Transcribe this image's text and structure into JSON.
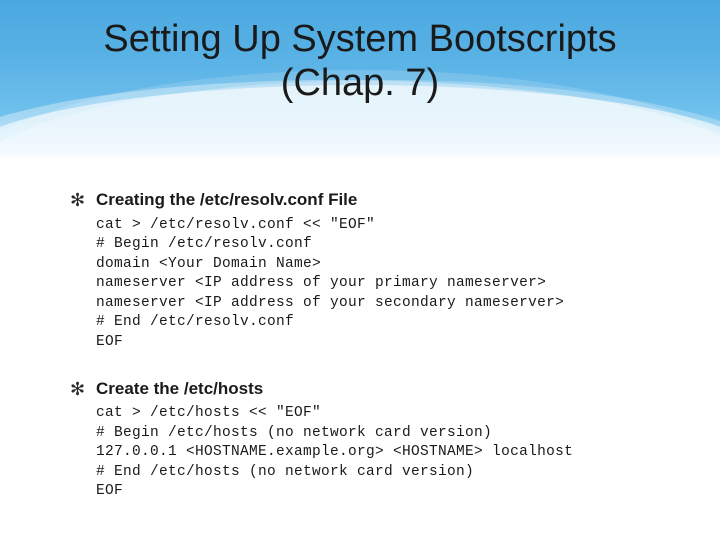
{
  "title_line1": "Setting Up System Bootscripts",
  "title_line2": "(Chap. 7)",
  "sections": [
    {
      "heading": "Creating the /etc/resolv.conf File",
      "code": "cat > /etc/resolv.conf << \"EOF\"\n# Begin /etc/resolv.conf\ndomain <Your Domain Name>\nnameserver <IP address of your primary nameserver>\nnameserver <IP address of your secondary nameserver>\n# End /etc/resolv.conf\nEOF"
    },
    {
      "heading": "Create the /etc/hosts",
      "code": "cat > /etc/hosts << \"EOF\"\n# Begin /etc/hosts (no network card version)\n127.0.0.1 <HOSTNAME.example.org> <HOSTNAME> localhost\n# End /etc/hosts (no network card version)\nEOF"
    }
  ]
}
